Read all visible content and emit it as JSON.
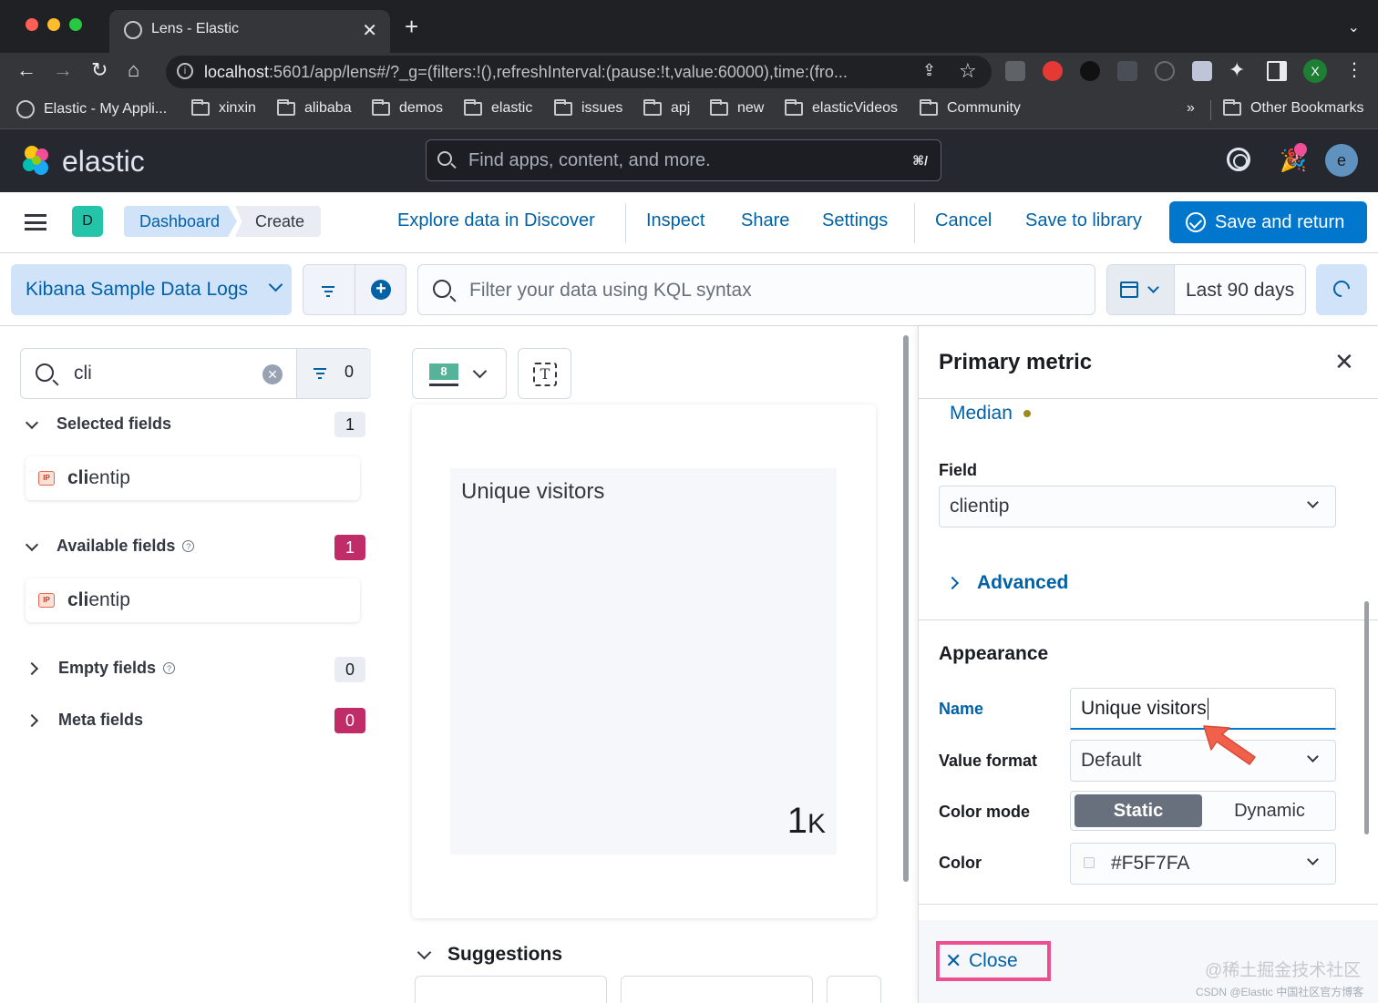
{
  "browser": {
    "tab_title": "Lens - Elastic",
    "url_host": "localhost",
    "url_rest": ":5601/app/lens#/?_g=(filters:!(),refreshInterval:(pause:!t,value:60000),time:(fro...",
    "profile_initial": "X",
    "bookmarks": [
      "Elastic - My Appli...",
      "xinxin",
      "alibaba",
      "demos",
      "elastic",
      "issues",
      "apj",
      "new",
      "elasticVideos",
      "Community"
    ],
    "bookmarks_overflow": "»",
    "other_bookmarks": "Other Bookmarks"
  },
  "kibana_header": {
    "brand": "elastic",
    "search_placeholder": "Find apps, content, and more.",
    "search_shortcut": "⌘/",
    "avatar_initial": "e"
  },
  "app_bar": {
    "space_initial": "D",
    "breadcrumbs": [
      "Dashboard",
      "Create"
    ],
    "actions": {
      "explore": "Explore data in Discover",
      "inspect": "Inspect",
      "share": "Share",
      "settings": "Settings",
      "cancel": "Cancel",
      "save_library": "Save to library",
      "save_return": "Save and return"
    }
  },
  "query_bar": {
    "data_view": "Kibana Sample Data Logs",
    "kql_placeholder": "Filter your data using KQL syntax",
    "time_range": "Last 90 days"
  },
  "field_list": {
    "search_value": "cli",
    "filter_count": "0",
    "selected": {
      "label": "Selected fields",
      "count": "1",
      "field_match": "cli",
      "field_rest": "entip"
    },
    "available": {
      "label": "Available fields",
      "count": "1",
      "field_match": "cli",
      "field_rest": "entip"
    },
    "empty": {
      "label": "Empty fields",
      "count": "0"
    },
    "meta": {
      "label": "Meta fields",
      "count": "0"
    },
    "ip_badge": "IP"
  },
  "workspace": {
    "chart_type_badge": "8",
    "metric_title": "Unique visitors",
    "metric_value": "1",
    "metric_suffix": "K",
    "suggestions_label": "Suggestions"
  },
  "flyout": {
    "title": "Primary metric",
    "function": "Median",
    "field_label": "Field",
    "field_value": "clientip",
    "advanced_label": "Advanced",
    "appearance_label": "Appearance",
    "name_label": "Name",
    "name_value": "Unique visitors",
    "value_format_label": "Value format",
    "value_format_value": "Default",
    "color_mode_label": "Color mode",
    "color_mode_options": [
      "Static",
      "Dynamic"
    ],
    "color_mode_selected": "Static",
    "color_label": "Color",
    "color_value": "#F5F7FA",
    "close_label": "Close"
  },
  "watermark": {
    "line1": "@稀土掘金技术社区",
    "line2": "CSDN @Elastic 中国社区官方博客"
  },
  "colors": {
    "primary": "#0077CC",
    "link": "#0061A6",
    "header_bg": "#25282F",
    "highlight_box": "#EE4F90"
  }
}
